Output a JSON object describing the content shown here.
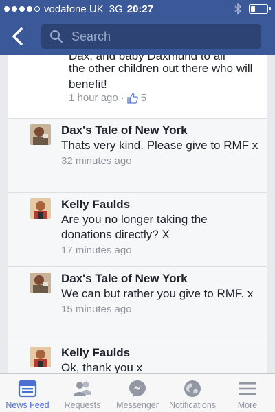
{
  "status": {
    "carrier": "vodafone UK",
    "network": "3G",
    "time": "20:27"
  },
  "header": {
    "search_placeholder": "Search"
  },
  "post": {
    "cut_text": "Dax, and baby Daxmund to all",
    "text": "the other children out there who will benefit!",
    "time": "1 hour ago",
    "likes": "5"
  },
  "comments": [
    {
      "name": "Dax's Tale of New York",
      "text": "Thats very kind. Please give to RMF x",
      "time": "32 minutes ago"
    },
    {
      "name": "Kelly Faulds",
      "text": "Are you no longer taking the donations directly? X",
      "time": "17 minutes ago"
    },
    {
      "name": "Dax's Tale of New York",
      "text": "We can but rather you give to RMF. x",
      "time": "15 minutes ago"
    },
    {
      "name": "Kelly Faulds",
      "text": "Ok, thank you x",
      "time": ""
    }
  ],
  "tabs": [
    {
      "label": "News Feed",
      "icon": "news-feed-icon",
      "active": true
    },
    {
      "label": "Requests",
      "icon": "requests-icon",
      "active": false
    },
    {
      "label": "Messenger",
      "icon": "messenger-icon",
      "active": false
    },
    {
      "label": "Notifications",
      "icon": "notifications-icon",
      "active": false
    },
    {
      "label": "More",
      "icon": "more-icon",
      "active": false
    }
  ],
  "colors": {
    "brand": "#3b5998",
    "active_tab": "#4a6fd1"
  }
}
